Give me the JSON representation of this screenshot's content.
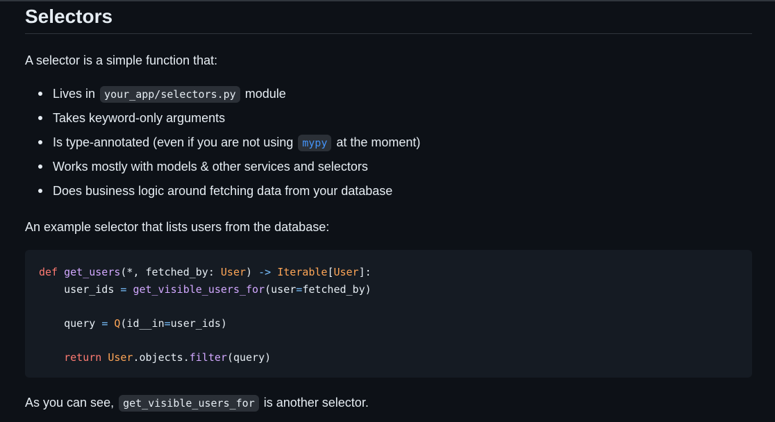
{
  "heading": "Selectors",
  "intro": "A selector is a simple function that:",
  "bullets": {
    "b1": {
      "pre": "Lives in ",
      "code": "your_app/selectors.py",
      "post": " module"
    },
    "b2": {
      "text": "Takes keyword-only arguments"
    },
    "b3": {
      "pre": "Is type-annotated (even if you are not using ",
      "code": "mypy",
      "post": " at the moment)"
    },
    "b4": {
      "text": "Works mostly with models & other services and selectors"
    },
    "b5": {
      "text": "Does business logic around fetching data from your database"
    }
  },
  "example_intro": "An example selector that lists users from the database:",
  "code": {
    "l1": {
      "def": "def",
      "sp": " ",
      "fn": "get_users",
      "args": "(*, fetched_by: ",
      "type1": "User",
      "close": ") ",
      "arrow": "->",
      "sp2": " ",
      "ret": "Iterable",
      "lb": "[",
      "ret2": "User",
      "rb": "]:"
    },
    "l2": {
      "indent": "    ",
      "var": "user_ids ",
      "eq": "=",
      "sp": " ",
      "call": "get_visible_users_for",
      "args": "(user",
      "eq2": "=",
      "rest": "fetched_by)"
    },
    "l4": {
      "indent": "    ",
      "var": "query ",
      "eq": "=",
      "sp": " ",
      "call": "Q",
      "args": "(id__in",
      "eq2": "=",
      "rest": "user_ids)"
    },
    "l6": {
      "indent": "    ",
      "kw": "return",
      "sp": " ",
      "cls": "User",
      "mid": ".objects.",
      "fn": "filter",
      "rest": "(query)"
    }
  },
  "outro": {
    "pre": "As you can see, ",
    "code": "get_visible_users_for",
    "post": " is another selector."
  },
  "colors": {
    "background": "#0d1117",
    "code_background": "#151b23",
    "keyword": "#ff7b72",
    "function": "#d2a8ff",
    "class": "#ffa657",
    "operator": "#79c0ff",
    "link_code": "#4493f8"
  }
}
